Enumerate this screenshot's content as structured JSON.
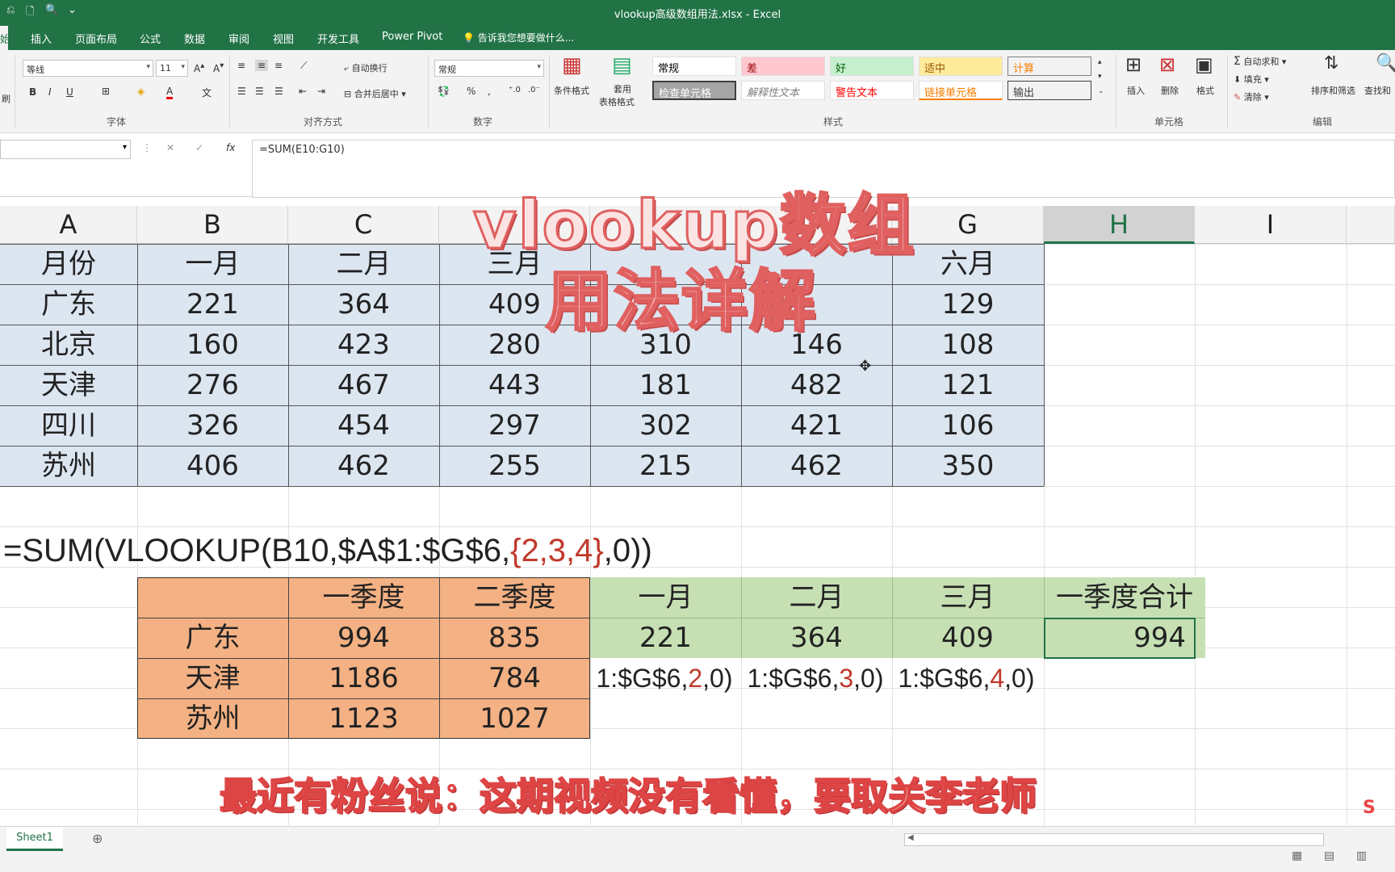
{
  "window_title": "vlookup高级数组用法.xlsx - Excel",
  "ribbon_tabs": [
    "插入",
    "页面布局",
    "公式",
    "数据",
    "审阅",
    "视图",
    "开发工具",
    "Power Pivot"
  ],
  "tell_me": "告诉我您想要做什么...",
  "font": {
    "name": "等线",
    "size": "11",
    "group": "字体"
  },
  "alignment": {
    "wrap": "自动换行",
    "merge": "合并后居中",
    "group": "对齐方式"
  },
  "number": {
    "format": "常规",
    "group": "数字"
  },
  "styles": {
    "cond_format": "条件格式",
    "table_format_1": "套用",
    "table_format_2": "表格格式",
    "group": "样式",
    "cells": [
      "常规",
      "差",
      "好",
      "适中",
      "计算",
      "检查单元格",
      "解释性文本",
      "警告文本",
      "链接单元格",
      "输出"
    ]
  },
  "cells_group": {
    "insert": "插入",
    "delete": "删除",
    "format": "格式",
    "group": "单元格"
  },
  "editing": {
    "autosum": "自动求和",
    "fill": "填充",
    "clear": "清除",
    "sort": "排序和筛选",
    "find": "查找和",
    "group": "编辑"
  },
  "formula_bar": {
    "formula": "=SUM(E10:G10)",
    "fx": "fx"
  },
  "col_headers": [
    "A",
    "B",
    "C",
    "",
    "",
    "",
    "G",
    "H",
    "I"
  ],
  "table1": {
    "header": [
      "月份",
      "一月",
      "二月",
      "三月",
      "",
      "",
      "六月"
    ],
    "rows": [
      [
        "广东",
        "221",
        "364",
        "409",
        "",
        "",
        "129"
      ],
      [
        "北京",
        "160",
        "423",
        "280",
        "310",
        "146",
        "108"
      ],
      [
        "天津",
        "276",
        "467",
        "443",
        "181",
        "482",
        "121"
      ],
      [
        "四川",
        "326",
        "454",
        "297",
        "302",
        "421",
        "106"
      ],
      [
        "苏州",
        "406",
        "462",
        "255",
        "215",
        "462",
        "350"
      ]
    ]
  },
  "formula_display": {
    "prefix": "=SUM(VLOOKUP(B10,$A$1:$G$6,",
    "array": "{2,3,4}",
    "suffix": ",0))"
  },
  "table2": {
    "header": [
      "一季度",
      "二季度"
    ],
    "rows": [
      [
        "广东",
        "994",
        "835"
      ],
      [
        "天津",
        "1186",
        "784"
      ],
      [
        "苏州",
        "1123",
        "1027"
      ]
    ]
  },
  "table3": {
    "header": [
      "一月",
      "二月",
      "三月",
      "一季度合计"
    ],
    "values": [
      "221",
      "364",
      "409",
      "994"
    ]
  },
  "partial_formulas": [
    {
      "pre": "1:$G$6,",
      "num": "2",
      "post": ",0)"
    },
    {
      "pre": "1:$G$6,",
      "num": "3",
      "post": ",0)"
    },
    {
      "pre": "1:$G$6,",
      "num": "4",
      "post": ",0)"
    }
  ],
  "overlay": {
    "line1": "vlookup数组",
    "line2": "用法详解"
  },
  "subtitle": "最近有粉丝说：这期视频没有看懂，要取关李老师",
  "sheet_tab": "Sheet1",
  "colors": {
    "excel_green": "#217346",
    "table1_fill": "#dce6f1",
    "table2_fill": "#f4b183",
    "table3_fill": "#c6e0b4",
    "red": "#c0392b"
  }
}
